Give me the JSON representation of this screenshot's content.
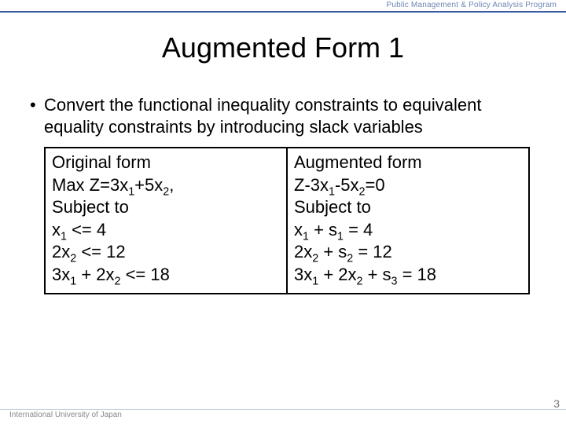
{
  "header": {
    "program": "Public Management & Policy Analysis Program"
  },
  "title": "Augmented Form 1",
  "bullet": {
    "text": "Convert the functional inequality constraints to equivalent equality constraints by introducing slack variables"
  },
  "table": {
    "left": {
      "l1": "Original form",
      "l2_pre": "Max Z=3x",
      "l2_mid": "+5x",
      "l2_post": ",",
      "l3": "Subject to",
      "l4_pre": "x",
      "l4_post": " <= 4",
      "l5_pre": "2x",
      "l5_post": " <= 12",
      "l6_a": "3x",
      "l6_b": " + 2x",
      "l6_c": " <= 18"
    },
    "right": {
      "l1": "Augmented form",
      "l2_a": "Z-3x",
      "l2_b": "-5x",
      "l2_c": "=0",
      "l3": "Subject to",
      "l4_a": "x",
      "l4_b": " + s",
      "l4_c": " = 4",
      "l5_a": "2x",
      "l5_b": " + s",
      "l5_c": " = 12",
      "l6_a": "3x",
      "l6_b": " + 2x",
      "l6_c": " + s",
      "l6_d": " = 18"
    }
  },
  "sub": {
    "one": "1",
    "two": "2",
    "three": "3"
  },
  "footer": {
    "org": "International University of Japan",
    "page": "3"
  }
}
